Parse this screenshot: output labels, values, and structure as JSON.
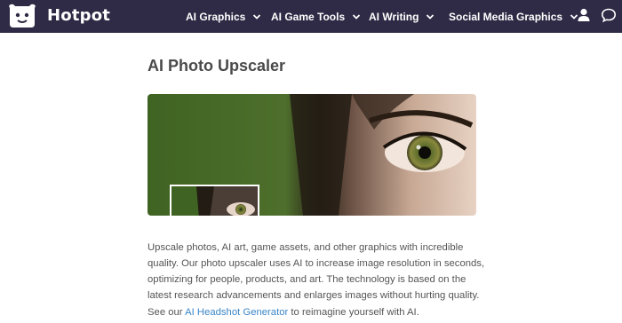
{
  "brand": {
    "name": "Hotpot"
  },
  "nav": {
    "items": [
      {
        "label": "AI Graphics"
      },
      {
        "label": "AI Game Tools"
      },
      {
        "label": "AI Writing"
      },
      {
        "label": "Social Media Graphics"
      }
    ],
    "icons": [
      "user-icon",
      "chat-icon"
    ]
  },
  "page": {
    "title": "AI Photo Upscaler",
    "description": "Upscale photos, AI art, game assets, and other graphics with incredible quality. Our photo upscaler uses AI to increase image resolution in seconds, optimizing for people, products, and art. The technology is based on the latest research advancements and enlarges images without hurting quality.",
    "see_prefix": "See our ",
    "see_link": "AI Headshot Generator",
    "see_suffix": " to reimagine yourself with AI."
  },
  "colors": {
    "topbar": "#2f2a45",
    "link": "#3a86c8",
    "title": "#4a4a4a"
  }
}
